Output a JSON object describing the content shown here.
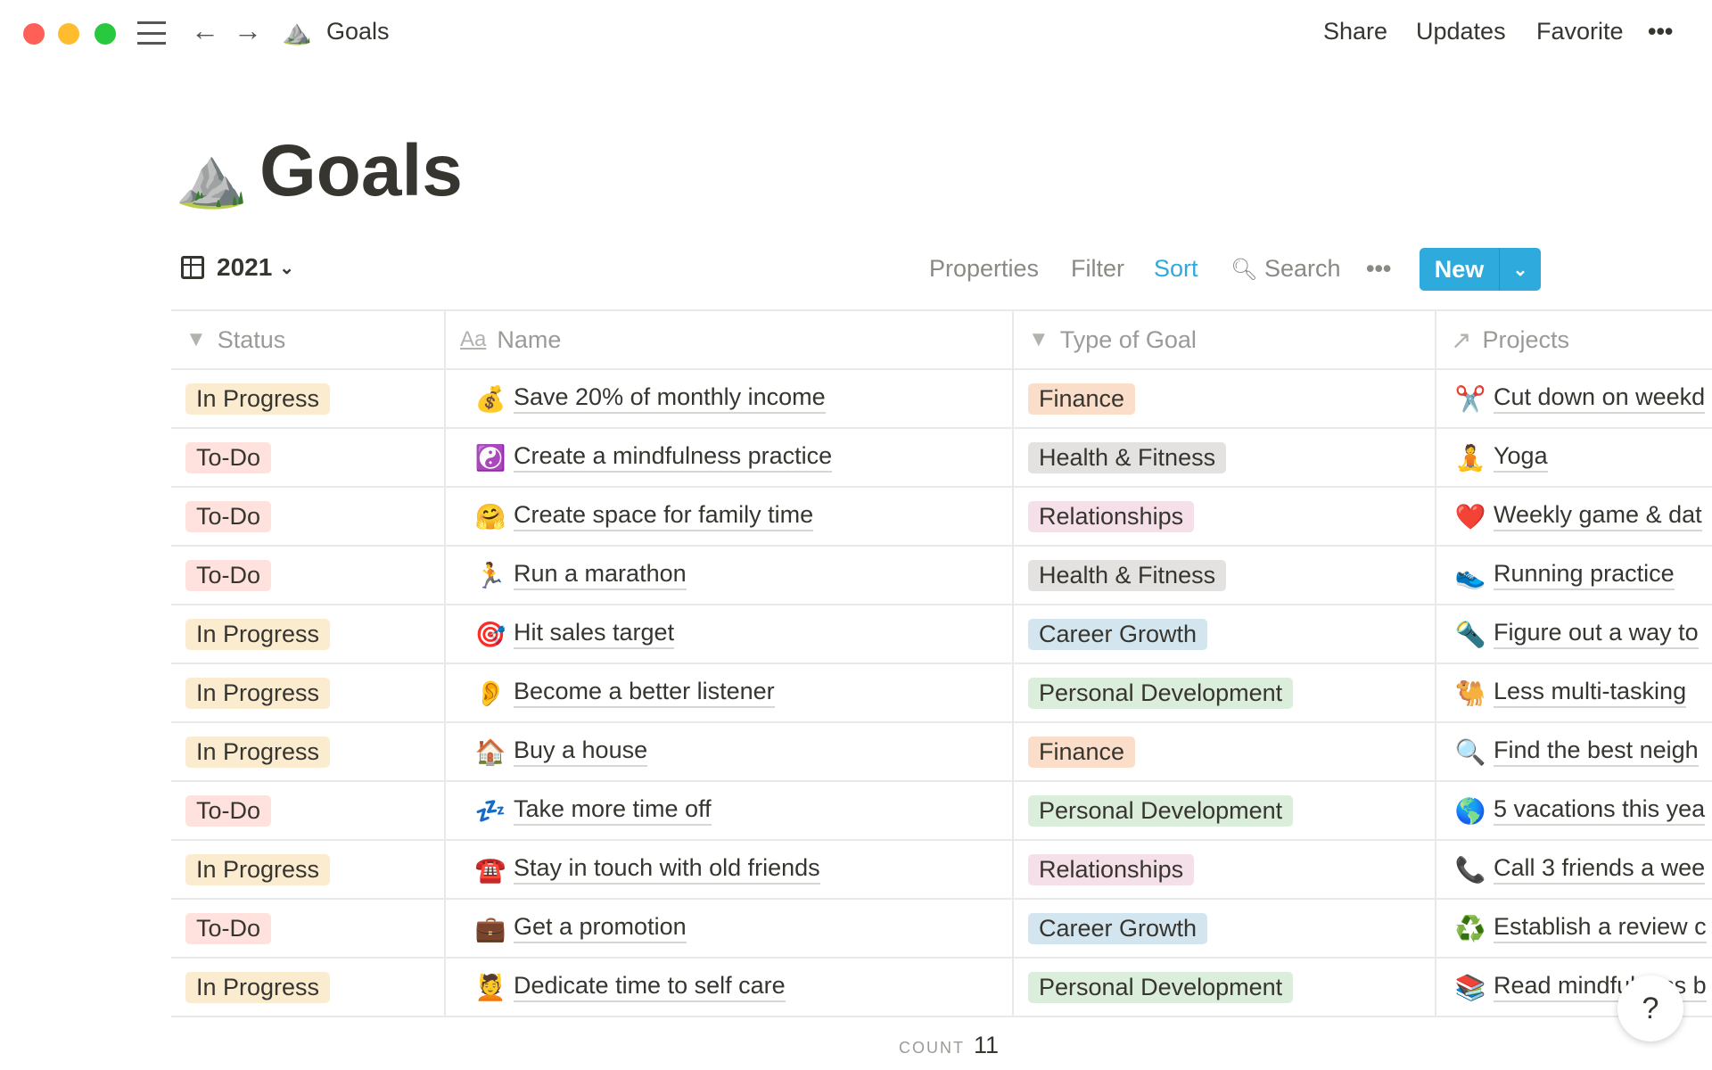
{
  "window": {
    "lights": [
      "#fe5f57",
      "#febc2e",
      "#28c840"
    ]
  },
  "topbar": {
    "page_icon": "⛰️",
    "page_title": "Goals",
    "share": "Share",
    "updates": "Updates",
    "favorite": "Favorite",
    "more": "•••"
  },
  "page": {
    "icon": "⛰️",
    "title": "Goals"
  },
  "toolbar": {
    "view_name": "2021",
    "properties": "Properties",
    "filter": "Filter",
    "sort": "Sort",
    "search": "Search",
    "more": "•••",
    "new": "New",
    "accent": "#2eaadc"
  },
  "table": {
    "headers": [
      "Status",
      "Name",
      "Type of Goal",
      "Projects"
    ],
    "rows": [
      {
        "status": "In Progress",
        "emoji": "💰",
        "name": "Save 20% of monthly income",
        "type": "Finance",
        "p_emoji": "✂️",
        "project": "Cut down on weekd"
      },
      {
        "status": "To-Do",
        "emoji": "☯️",
        "name": "Create a mindfulness practice",
        "type": "Health & Fitness",
        "p_emoji": "🧘",
        "project": "Yoga"
      },
      {
        "status": "To-Do",
        "emoji": "🤗",
        "name": "Create space for family time",
        "type": "Relationships",
        "p_emoji": "❤️",
        "project": "Weekly game & dat"
      },
      {
        "status": "To-Do",
        "emoji": "🏃",
        "name": "Run a marathon",
        "type": "Health & Fitness",
        "p_emoji": "👟",
        "project": "Running practice"
      },
      {
        "status": "In Progress",
        "emoji": "🎯",
        "name": "Hit sales target",
        "type": "Career Growth",
        "p_emoji": "🔦",
        "project": "Figure out a way to"
      },
      {
        "status": "In Progress",
        "emoji": "👂",
        "name": "Become a better listener",
        "type": "Personal Development",
        "p_emoji": "🐫",
        "project": "Less multi-tasking"
      },
      {
        "status": "In Progress",
        "emoji": "🏠",
        "name": "Buy a house",
        "type": "Finance",
        "p_emoji": "🔍",
        "project": "Find the best neigh"
      },
      {
        "status": "To-Do",
        "emoji": "💤",
        "name": "Take more time off",
        "type": "Personal Development",
        "p_emoji": "🌎",
        "project": "5 vacations this yea"
      },
      {
        "status": "In Progress",
        "emoji": "☎️",
        "name": "Stay in touch with old friends",
        "type": "Relationships",
        "p_emoji": "📞",
        "project": "Call 3 friends a wee"
      },
      {
        "status": "To-Do",
        "emoji": "💼",
        "name": "Get a promotion",
        "type": "Career Growth",
        "p_emoji": "♻️",
        "project": "Establish a review c"
      },
      {
        "status": "In Progress",
        "emoji": "💆",
        "name": "Dedicate time to self care",
        "type": "Personal Development",
        "p_emoji": "📚",
        "project": "Read mindfulness b"
      }
    ],
    "count_label": "COUNT",
    "count": "11"
  },
  "tag_colors": {
    "In Progress": "#fbecd0",
    "To-Do": "#ffe2dd",
    "Finance": "#fadec9",
    "Health & Fitness": "#e3e2e0",
    "Relationships": "#f5e0e9",
    "Career Growth": "#d3e5ef",
    "Personal Development": "#dbeddb"
  },
  "help": "?"
}
